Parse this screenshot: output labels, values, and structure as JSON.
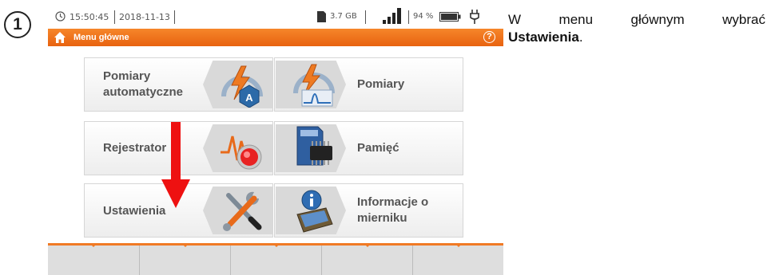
{
  "step_number": "1",
  "status_bar": {
    "time": "15:50:45",
    "date": "2018-11-13",
    "storage": "3.7 GB",
    "battery_percent": "94 %"
  },
  "title_bar": {
    "title": "Menu główne",
    "help_symbol": "?"
  },
  "menu": {
    "tiles": [
      {
        "label_line1": "Pomiary",
        "label_line2": "automatyczne",
        "icon": "auto-measurement-icon"
      },
      {
        "label_line1": "Pomiary",
        "label_line2": "",
        "icon": "measurement-icon"
      },
      {
        "label_line1": "Rejestrator",
        "label_line2": "",
        "icon": "recorder-icon"
      },
      {
        "label_line1": "Pamięć",
        "label_line2": "",
        "icon": "memory-card-icon"
      },
      {
        "label_line1": "Ustawienia",
        "label_line2": "",
        "icon": "settings-tools-icon"
      },
      {
        "label_line1": "Informacje o",
        "label_line2": "mierniku",
        "icon": "meter-info-icon"
      }
    ]
  },
  "instruction": {
    "words": [
      "W",
      "menu",
      "głównym",
      "wybrać"
    ],
    "bold": "Ustawienia",
    "tail": "."
  },
  "colors": {
    "accent_orange": "#f07a25",
    "arrow_red": "#ee1111"
  }
}
